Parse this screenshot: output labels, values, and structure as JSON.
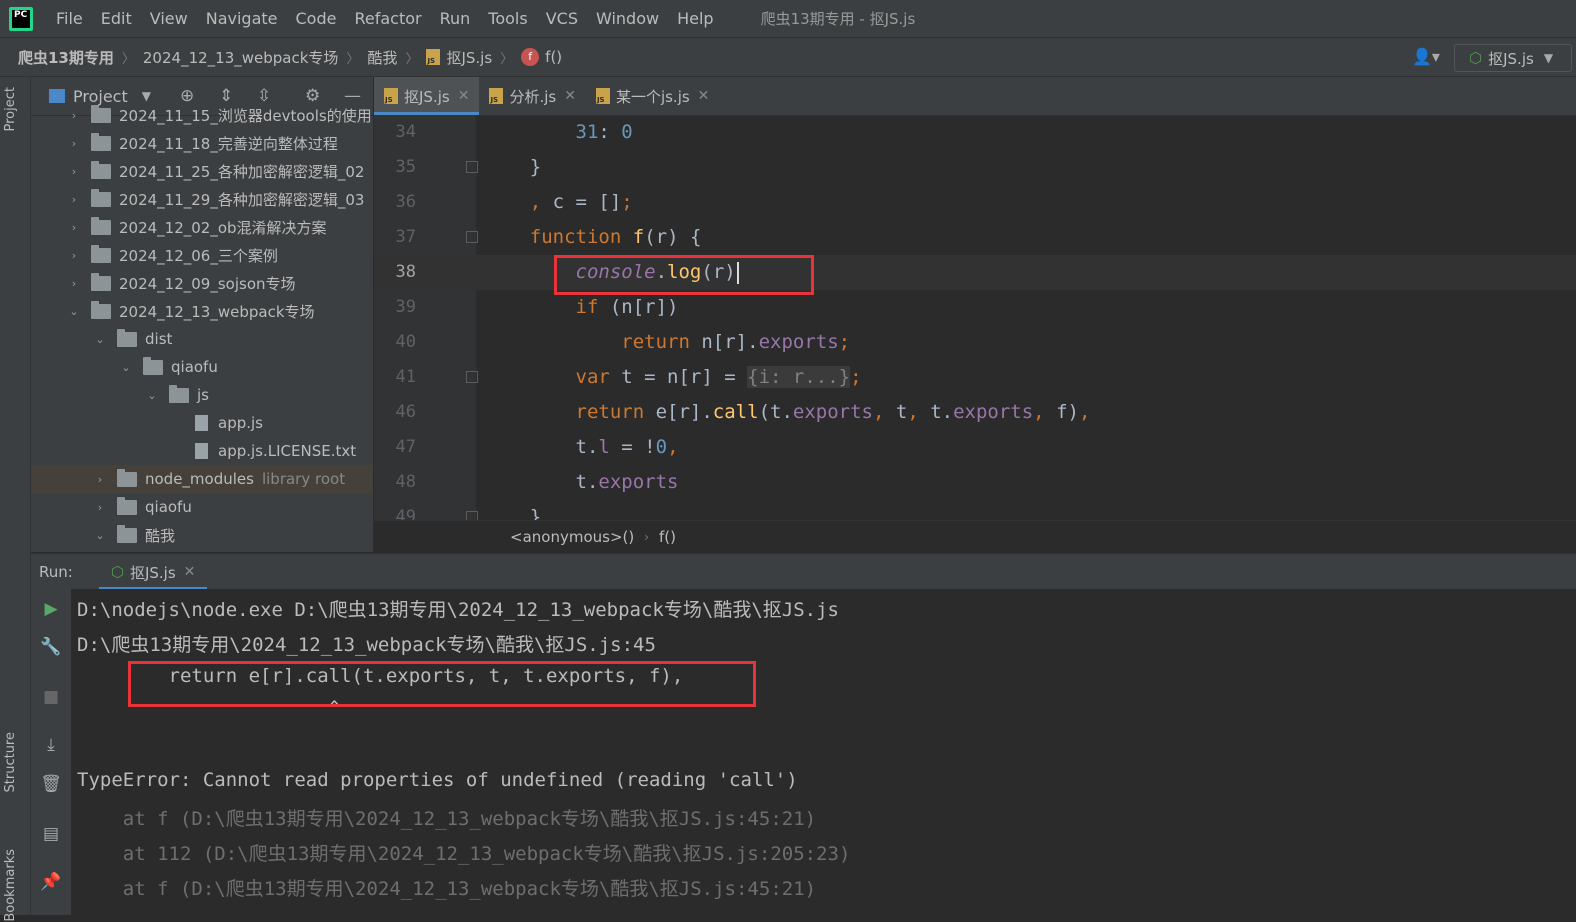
{
  "app": {
    "logo_text": "PC",
    "window_title": "爬虫13期专用 - 抠JS.js",
    "menu": [
      "File",
      "Edit",
      "View",
      "Navigate",
      "Code",
      "Refactor",
      "Run",
      "Tools",
      "VCS",
      "Window",
      "Help"
    ]
  },
  "navbar": {
    "crumbs": [
      "爬虫13期专用",
      "2024_12_13_webpack专场",
      "酷我",
      "抠JS.js",
      "f()"
    ],
    "run_config": "抠JS.js"
  },
  "side_tabs": {
    "project": "Project",
    "structure": "Structure",
    "bookmarks": "Bookmarks"
  },
  "project_panel": {
    "title": "Project",
    "tree": [
      {
        "label": "2024_11_15_浏览器devtools的使用",
        "type": "folder",
        "arrow": "›"
      },
      {
        "label": "2024_11_18_完善逆向整体过程",
        "type": "folder",
        "arrow": "›"
      },
      {
        "label": "2024_11_25_各种加密解密逻辑_02",
        "type": "folder",
        "arrow": "›"
      },
      {
        "label": "2024_11_29_各种加密解密逻辑_03",
        "type": "folder",
        "arrow": "›"
      },
      {
        "label": "2024_12_02_ob混淆解决方案",
        "type": "folder",
        "arrow": "›"
      },
      {
        "label": "2024_12_06_三个案例",
        "type": "folder",
        "arrow": "›"
      },
      {
        "label": "2024_12_09_sojson专场",
        "type": "folder",
        "arrow": "›"
      },
      {
        "label": "2024_12_13_webpack专场",
        "type": "folder",
        "arrow": "⌄"
      },
      {
        "label": "dist",
        "type": "folder",
        "arrow": "⌄"
      },
      {
        "label": "qiaofu",
        "type": "folder",
        "arrow": "⌄"
      },
      {
        "label": "js",
        "type": "folder",
        "arrow": "⌄"
      },
      {
        "label": "app.js",
        "type": "file",
        "arrow": ""
      },
      {
        "label": "app.js.LICENSE.txt",
        "type": "file",
        "arrow": ""
      },
      {
        "label": "node_modules",
        "type": "folder",
        "arrow": "›",
        "note": "library root"
      },
      {
        "label": "qiaofu",
        "type": "folder",
        "arrow": "›"
      },
      {
        "label": "酷我",
        "type": "folder",
        "arrow": "⌄"
      }
    ]
  },
  "editor": {
    "tabs": [
      {
        "label": "抠JS.js",
        "active": true
      },
      {
        "label": "分析.js",
        "active": false
      },
      {
        "label": "某一个js.js",
        "active": false
      }
    ],
    "lines": [
      {
        "n": "34",
        "t": "        31: 0"
      },
      {
        "n": "35",
        "t": "    }"
      },
      {
        "n": "36",
        "t": "    , c = [];"
      },
      {
        "n": "37",
        "t": "    function f(r) {"
      },
      {
        "n": "38",
        "t": "        console.log(r)"
      },
      {
        "n": "39",
        "t": "        if (n[r])"
      },
      {
        "n": "40",
        "t": "            return n[r].exports;"
      },
      {
        "n": "41",
        "t": "        var t = n[r] = {i: r...};"
      },
      {
        "n": "46",
        "t": "        return e[r].call(t.exports, t, t.exports, f),"
      },
      {
        "n": "47",
        "t": "        t.l = !0,"
      },
      {
        "n": "48",
        "t": "        t.exports"
      },
      {
        "n": "49",
        "t": "    }"
      }
    ],
    "breadcrumb": [
      "<anonymous>()",
      "f()"
    ]
  },
  "run": {
    "label": "Run:",
    "tab": "抠JS.js",
    "console": [
      "D:\\nodejs\\node.exe D:\\爬虫13期专用\\2024_12_13_webpack专场\\酷我\\抠JS.js",
      "D:\\爬虫13期专用\\2024_12_13_webpack专场\\酷我\\抠JS.js:45",
      "        return e[r].call(t.exports, t, t.exports, f),",
      "                      ^",
      "",
      "TypeError: Cannot read properties of undefined (reading 'call')",
      "    at f (D:\\爬虫13期专用\\2024_12_13_webpack专场\\酷我\\抠JS.js:45:21)",
      "    at 112 (D:\\爬虫13期专用\\2024_12_13_webpack专场\\酷我\\抠JS.js:205:23)",
      "    at f (D:\\爬虫13期专用\\2024_12_13_webpack专场\\酷我\\抠JS.js:45:21)"
    ]
  },
  "colors": {
    "highlight_box": "#e8333a",
    "accent": "#4a88c7"
  }
}
